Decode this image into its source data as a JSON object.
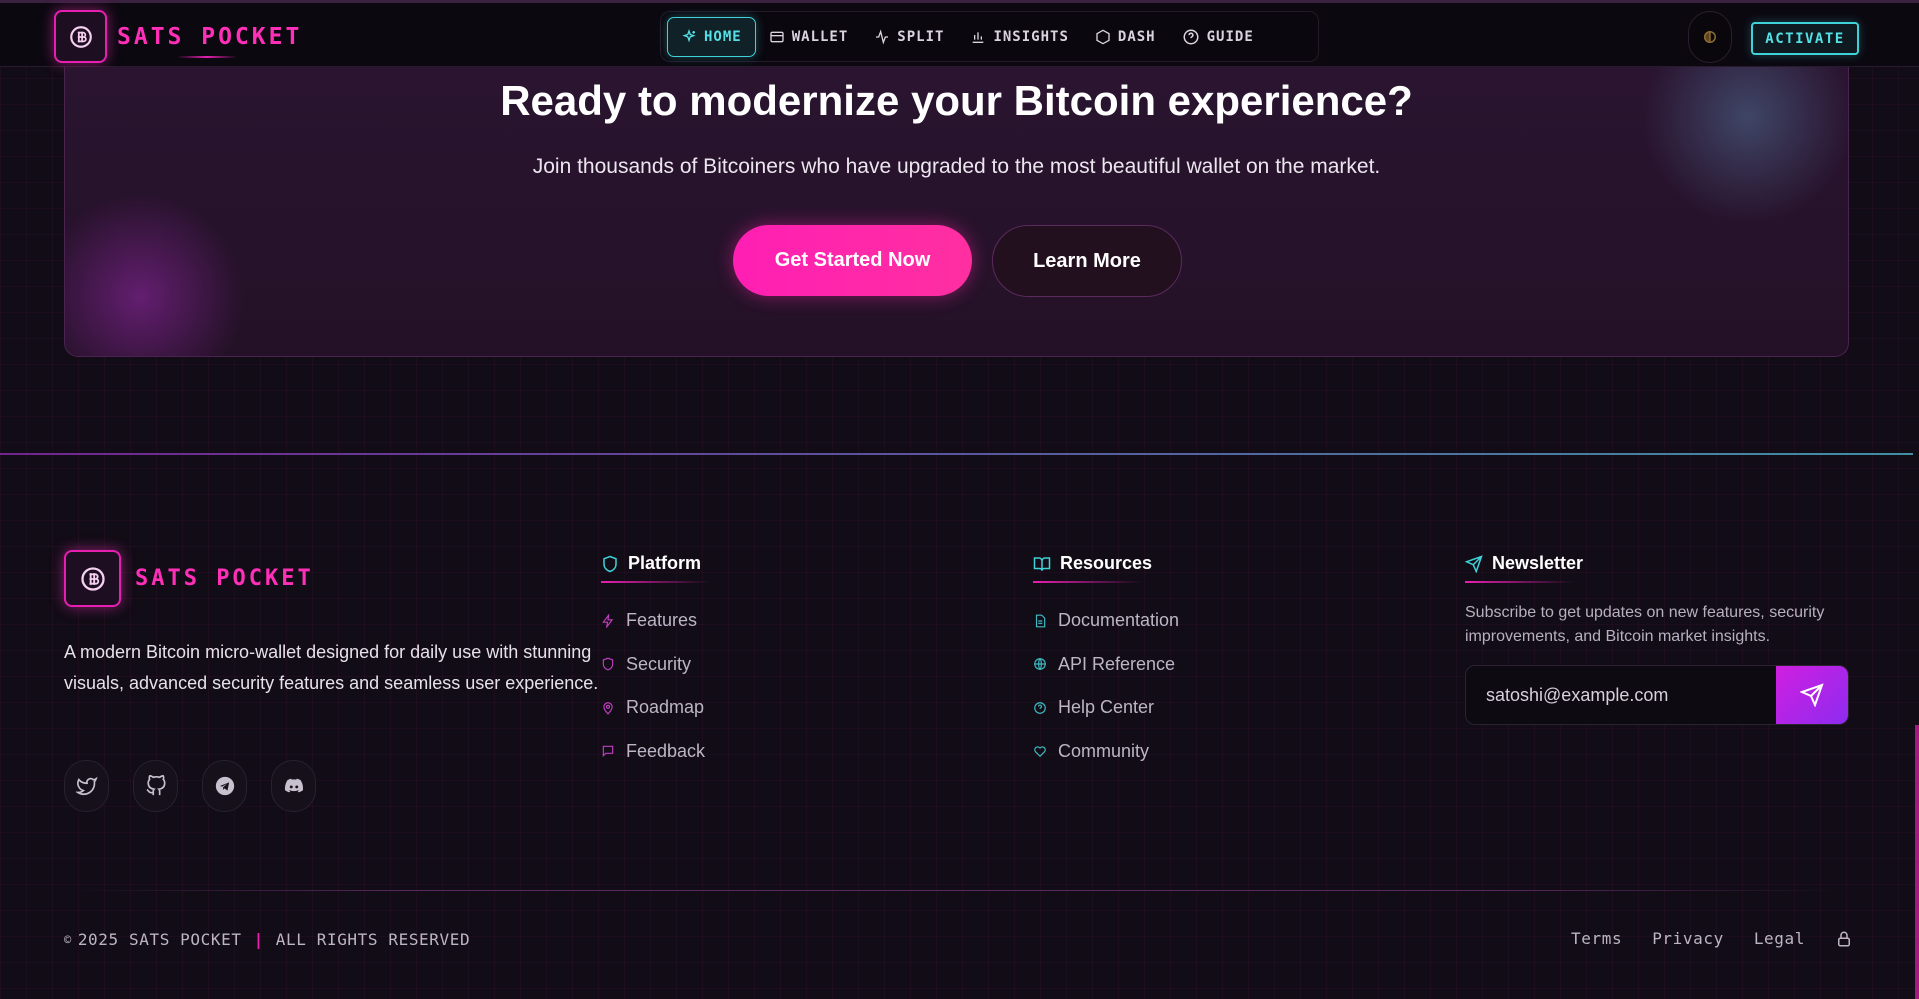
{
  "colors": {
    "brand_pink": "#ff2fb8",
    "accent_cyan": "#3fd2d8",
    "cta_gradient": [
      "#ff1fb4",
      "#ff2fa0"
    ],
    "send_gradient": [
      "#d01fe0",
      "#8d2bf0"
    ]
  },
  "header": {
    "brand": "SATS POCKET",
    "nav": [
      {
        "label": "HOME",
        "icon": "sparkle-icon",
        "active": true
      },
      {
        "label": "WALLET",
        "icon": "wallet-icon"
      },
      {
        "label": "SPLIT",
        "icon": "activity-icon"
      },
      {
        "label": "INSIGHTS",
        "icon": "bar-chart-icon"
      },
      {
        "label": "DASH",
        "icon": "hexagon-icon"
      },
      {
        "label": "GUIDE",
        "icon": "help-circle-icon"
      }
    ],
    "theme_icon": "moon-icon",
    "activate_label": "ACTIVATE"
  },
  "cta": {
    "title": "Ready to modernize your Bitcoin experience?",
    "subtitle": "Join thousands of Bitcoiners who have upgraded to the most beautiful wallet on the market.",
    "primary_label": "Get Started Now",
    "secondary_label": "Learn More"
  },
  "footer": {
    "brand": "SATS POCKET",
    "description": "A modern Bitcoin micro-wallet designed for daily use with stunning visuals, advanced security features and seamless user experience.",
    "socials": [
      "twitter-icon",
      "github-icon",
      "telegram-icon",
      "discord-icon"
    ],
    "platform": {
      "heading": "Platform",
      "icon": "shield-icon",
      "items": [
        {
          "label": "Features",
          "icon": "zap-icon"
        },
        {
          "label": "Security",
          "icon": "shield-icon"
        },
        {
          "label": "Roadmap",
          "icon": "map-pin-icon"
        },
        {
          "label": "Feedback",
          "icon": "message-icon"
        }
      ]
    },
    "resources": {
      "heading": "Resources",
      "icon": "book-open-icon",
      "items": [
        {
          "label": "Documentation",
          "icon": "file-text-icon"
        },
        {
          "label": "API Reference",
          "icon": "globe-icon"
        },
        {
          "label": "Help Center",
          "icon": "help-circle-icon"
        },
        {
          "label": "Community",
          "icon": "heart-icon"
        }
      ]
    },
    "newsletter": {
      "heading": "Newsletter",
      "icon": "send-icon",
      "text": "Subscribe to get updates on new features, security improvements, and Bitcoin market insights.",
      "input_value": "satoshi@example.com",
      "submit_icon": "send-icon"
    },
    "bottom": {
      "copyright_symbol": "©",
      "copyright_year_brand": "2025 SATS POCKET",
      "separator": "|",
      "rights": "ALL RIGHTS RESERVED",
      "links": [
        "Terms",
        "Privacy",
        "Legal"
      ],
      "lock_icon": "lock-icon"
    }
  }
}
